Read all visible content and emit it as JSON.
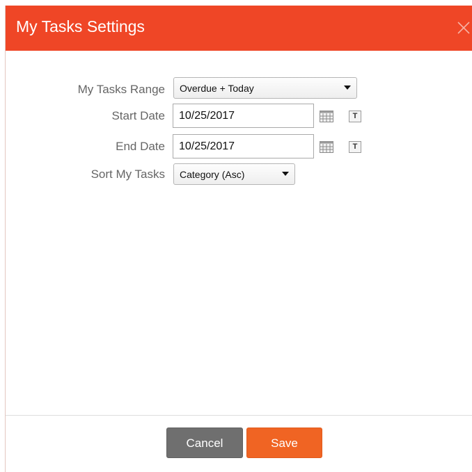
{
  "dialog": {
    "title": "My Tasks Settings",
    "close_icon": "close-icon",
    "accent_color": "#ef4626"
  },
  "form": {
    "range": {
      "label": "My Tasks Range",
      "value": "Overdue + Today"
    },
    "start_date": {
      "label": "Start Date",
      "value": "10/25/2017",
      "calendar_icon": "calendar-icon",
      "today_icon": "today-icon",
      "today_glyph": "T"
    },
    "end_date": {
      "label": "End Date",
      "value": "10/25/2017",
      "calendar_icon": "calendar-icon",
      "today_icon": "today-icon",
      "today_glyph": "T"
    },
    "sort": {
      "label": "Sort My Tasks",
      "value": "Category (Asc)"
    }
  },
  "footer": {
    "cancel_label": "Cancel",
    "save_label": "Save",
    "save_color": "#f06423",
    "cancel_color": "#6f6f6f"
  }
}
